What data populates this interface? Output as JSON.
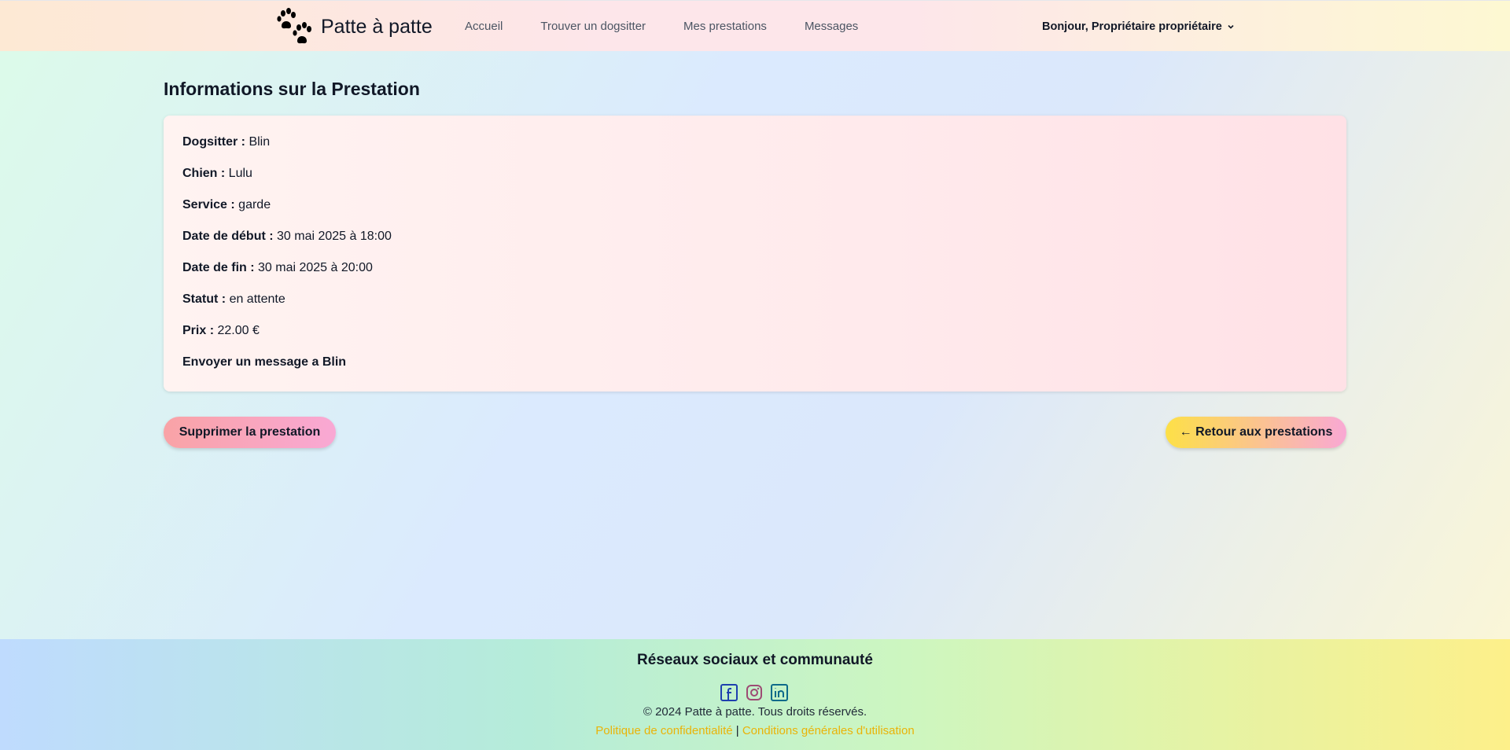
{
  "header": {
    "brand_name": "Patte à patte",
    "nav": [
      {
        "label": "Accueil"
      },
      {
        "label": "Trouver un dogsitter"
      },
      {
        "label": "Mes prestations"
      },
      {
        "label": "Messages"
      }
    ],
    "user_greeting": "Bonjour, Propriétaire propriétaire"
  },
  "main": {
    "title": "Informations sur la Prestation",
    "details": [
      {
        "label": "Dogsitter :",
        "value": "Blin"
      },
      {
        "label": "Chien :",
        "value": "Lulu"
      },
      {
        "label": "Service :",
        "value": "garde"
      },
      {
        "label": "Date de début :",
        "value": "30 mai 2025 à 18:00"
      },
      {
        "label": "Date de fin :",
        "value": "30 mai 2025 à 20:00"
      },
      {
        "label": "Statut :",
        "value": "en attente"
      },
      {
        "label": "Prix :",
        "value": "22.00 €"
      }
    ],
    "message_link": "Envoyer un message a Blin",
    "delete_button": "Supprimer la prestation",
    "back_button": "← Retour aux prestations"
  },
  "footer": {
    "title": "Réseaux sociaux et communauté",
    "socials": [
      "facebook-icon",
      "instagram-icon",
      "linkedin-icon"
    ],
    "copyright": "© 2024 Patte à patte. Tous droits réservés.",
    "privacy_link": "Politique de confidentialité",
    "separator": "|",
    "terms_link": "Conditions générales d'utilisation"
  },
  "colors": {
    "accent_link": "#eab308",
    "facebook": "#1e40af",
    "instagram": "#9d4b74",
    "linkedin": "#0e6a8a"
  }
}
